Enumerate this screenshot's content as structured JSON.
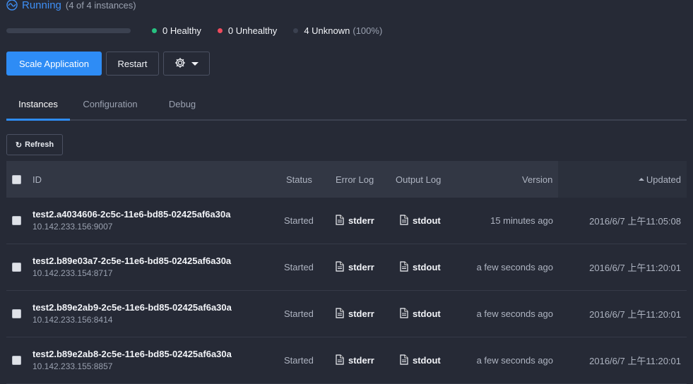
{
  "status": {
    "title": "Running",
    "count": "(4 of 4 instances)"
  },
  "health": {
    "healthy": "0 Healthy",
    "unhealthy": "0 Unhealthy",
    "unknown": "4 Unknown",
    "unknown_pct": "(100%)",
    "colors": {
      "healthy": "#27c281",
      "unhealthy": "#ef4b5d",
      "unknown": "#3b4150"
    }
  },
  "toolbar": {
    "scale_label": "Scale Application",
    "restart_label": "Restart",
    "settings_icon": "gear-icon"
  },
  "tabs": [
    {
      "label": "Instances",
      "active": true
    },
    {
      "label": "Configuration",
      "active": false
    },
    {
      "label": "Debug",
      "active": false
    }
  ],
  "refresh_label": "Refresh",
  "table": {
    "headers": {
      "id": "ID",
      "status": "Status",
      "error_log": "Error Log",
      "output_log": "Output Log",
      "version": "Version",
      "updated": "Updated"
    },
    "rows": [
      {
        "id": "test2.a4034606-2c5c-11e6-bd85-02425af6a30a",
        "address": "10.142.233.156:9007",
        "status": "Started",
        "error_log": "stderr",
        "output_log": "stdout",
        "version": "15 minutes ago",
        "updated": "2016/6/7 上午11:05:08"
      },
      {
        "id": "test2.b89e03a7-2c5e-11e6-bd85-02425af6a30a",
        "address": "10.142.233.154:8717",
        "status": "Started",
        "error_log": "stderr",
        "output_log": "stdout",
        "version": "a few seconds ago",
        "updated": "2016/6/7 上午11:20:01"
      },
      {
        "id": "test2.b89e2ab9-2c5e-11e6-bd85-02425af6a30a",
        "address": "10.142.233.156:8414",
        "status": "Started",
        "error_log": "stderr",
        "output_log": "stdout",
        "version": "a few seconds ago",
        "updated": "2016/6/7 上午11:20:01"
      },
      {
        "id": "test2.b89e2ab8-2c5e-11e6-bd85-02425af6a30a",
        "address": "10.142.233.155:8857",
        "status": "Started",
        "error_log": "stderr",
        "output_log": "stdout",
        "version": "a few seconds ago",
        "updated": "2016/6/7 上午11:20:01"
      }
    ]
  }
}
